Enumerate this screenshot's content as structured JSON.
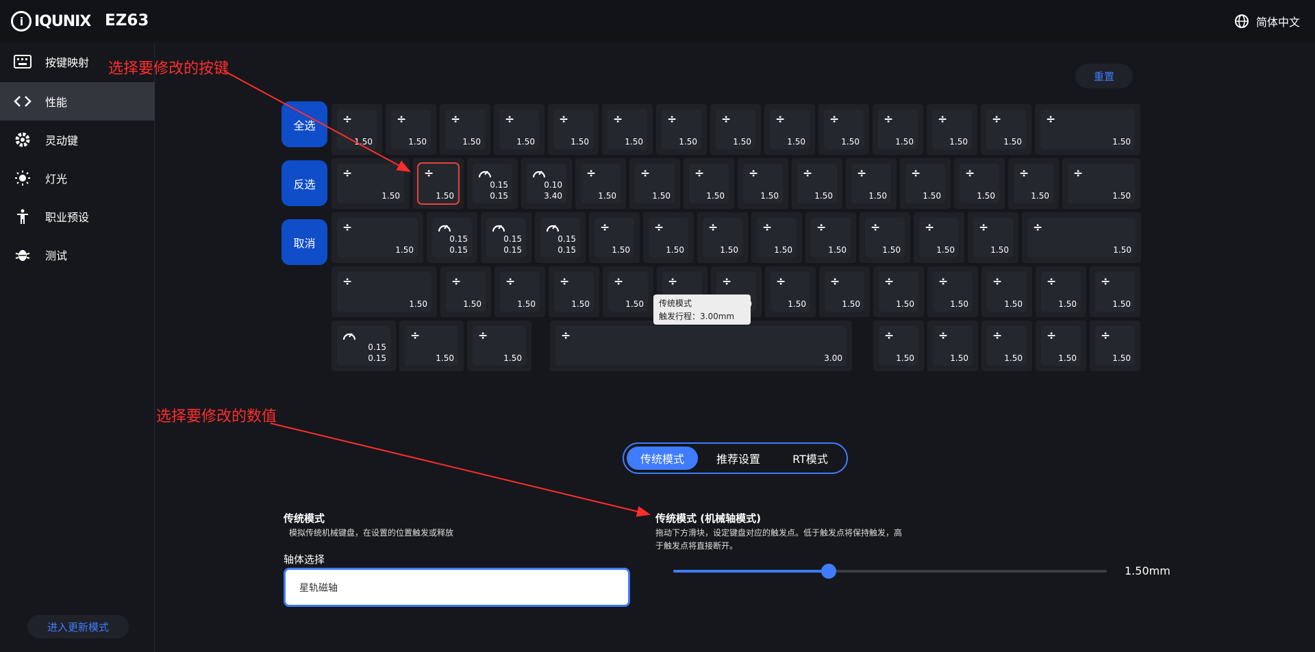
{
  "app": {
    "brand": "IQUNIX",
    "model": "EZ63",
    "language": "简体中文"
  },
  "sidebar": {
    "items": [
      {
        "label": "按键映射",
        "icon": "keyboard-icon"
      },
      {
        "label": "性能",
        "icon": "code-icon",
        "active": true
      },
      {
        "label": "灵动键",
        "icon": "gear-icon"
      },
      {
        "label": "灯光",
        "icon": "sun-icon"
      },
      {
        "label": "职业预设",
        "icon": "person-icon"
      },
      {
        "label": "测试",
        "icon": "bug-icon"
      }
    ],
    "update_label": "进入更新模式"
  },
  "toolbar": {
    "reset_label": "重置"
  },
  "selection": {
    "select_all": "全选",
    "invert": "反选",
    "cancel": "取消"
  },
  "keyboard": {
    "row1": [
      "1.50",
      "1.50",
      "1.50",
      "1.50",
      "1.50",
      "1.50",
      "1.50",
      "1.50",
      "1.50",
      "1.50",
      "1.50",
      "1.50",
      "1.50",
      "1.50"
    ],
    "row2": [
      "1.50",
      "1.50",
      [
        "0.15",
        "0.15"
      ],
      [
        "0.10",
        "3.40"
      ],
      "1.50",
      "1.50",
      "1.50",
      "1.50",
      "1.50",
      "1.50",
      "1.50",
      "1.50",
      "1.50",
      "1.50"
    ],
    "row3": [
      "1.50",
      [
        "0.15",
        "0.15"
      ],
      [
        "0.15",
        "0.15"
      ],
      [
        "0.15",
        "0.15"
      ],
      "1.50",
      "1.50",
      "1.50",
      "1.50",
      "1.50",
      "1.50",
      "1.50",
      "1.50",
      "1.50"
    ],
    "row4": [
      "1.50",
      "1.50",
      "1.50",
      "1.50",
      "1.50",
      "1.50",
      "1.50",
      "1.50",
      "1.50",
      "1.50",
      "1.50",
      "1.50",
      "1.50",
      "1.50"
    ],
    "row5": [
      [
        "0.15",
        "0.15"
      ],
      "1.50",
      "1.50",
      "3.00",
      "1.50",
      "1.50",
      "1.50",
      "1.50",
      "1.50"
    ]
  },
  "tooltip": {
    "line1": "传统模式",
    "line2": "触发行程：3.00mm"
  },
  "modes": {
    "tabs": [
      "传统模式",
      "推荐设置",
      "RT模式"
    ],
    "active": 0
  },
  "left_panel": {
    "title": "传统模式",
    "desc": "模拟传统机械键盘，在设置的位置触发或释放",
    "axis_label": "轴体选择",
    "axis_value": "星轨磁轴"
  },
  "right_panel": {
    "title": "传统模式 (机械轴模式)",
    "desc1": "拖动下方滑块，设定键盘对应的触发点。低于触发点将保持触发，高",
    "desc2": "于触发点将直接断开。",
    "slider_value": "1.50mm",
    "slider_fraction": 0.36
  },
  "annotations": {
    "a1": "选择要修改的按键",
    "a2": "选择要修改的数值"
  },
  "colors": {
    "accent": "#3f7cff",
    "select_btn": "#0f4dc9",
    "annotation": "#ff2d2d"
  }
}
